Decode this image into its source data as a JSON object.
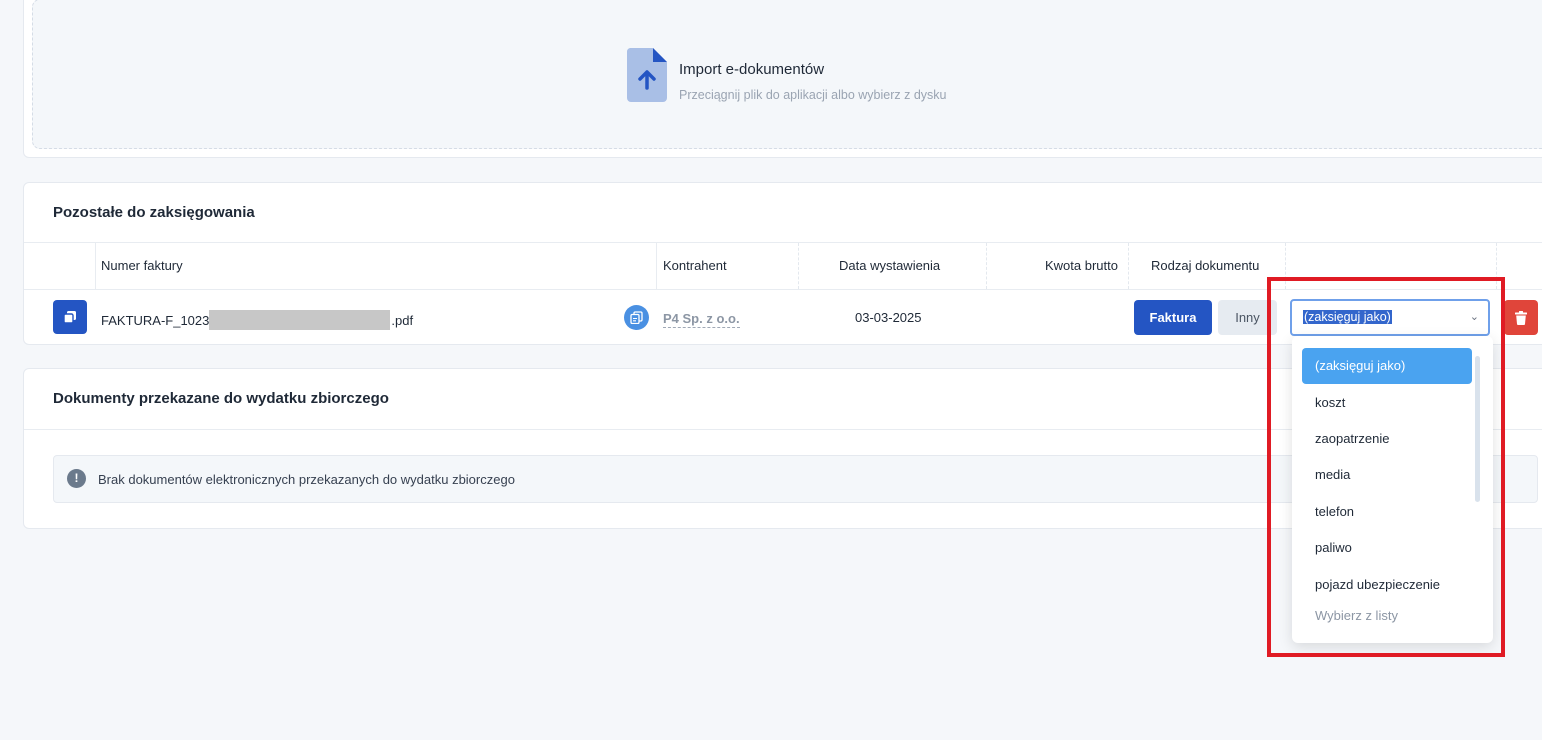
{
  "import": {
    "title": "Import e-dokumentów",
    "subtitle": "Przeciągnij plik do aplikacji albo wybierz z dysku",
    "icon": "file-upload-icon"
  },
  "remaining": {
    "title": "Pozostałe do zaksięgowania",
    "columns": {
      "invoice_number": "Numer faktury",
      "contractor": "Kontrahent",
      "issue_date": "Data wystawienia",
      "gross_amount": "Kwota brutto",
      "document_type": "Rodzaj dokumentu"
    },
    "row": {
      "filename_prefix": "FAKTURA-F_1023",
      "filename_suffix": ".pdf",
      "contractor": "P4 Sp. z o.o.",
      "date": "03-03-2025",
      "gross_amount": "",
      "type_buttons": [
        "Faktura",
        "Inny"
      ],
      "book_as_value": "(zaksięguj jako)"
    }
  },
  "collective": {
    "title": "Dokumenty przekazane do wydatku zbiorczego",
    "empty_message": "Brak dokumentów elektronicznych przekazanych do wydatku zbiorczego"
  },
  "dropdown": {
    "options": [
      "(zaksięguj jako)",
      "koszt",
      "zaopatrzenie",
      "media",
      "telefon",
      "paliwo",
      "pojazd ubezpieczenie"
    ],
    "selected_index": 0,
    "placeholder": "Wybierz z listy"
  },
  "colors": {
    "primary": "#2455c3",
    "accent": "#4aa3f0",
    "danger": "#e0453a",
    "highlight": "#e01b24"
  }
}
